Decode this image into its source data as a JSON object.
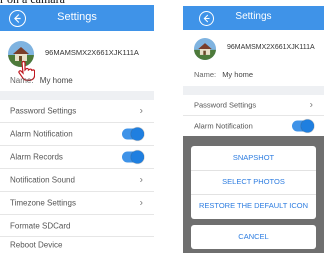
{
  "caption": "r on a camara",
  "left_screen": {
    "header_title": "Settings",
    "device_serial": "96MAMSMX2X661XJK111A",
    "name_label": "Name:",
    "name_value": "My home",
    "rows": [
      {
        "label": "Password Settings",
        "control": "chevron"
      },
      {
        "label": "Alarm Notification",
        "control": "toggle",
        "on": true
      },
      {
        "label": "Alarm Records",
        "control": "toggle",
        "on": true
      },
      {
        "label": "Notification Sound",
        "control": "chevron"
      },
      {
        "label": "Timezone Settings",
        "control": "chevron"
      },
      {
        "label": "Formate SDCard",
        "control": "none"
      },
      {
        "label": "Reboot Device",
        "control": "none"
      }
    ]
  },
  "right_screen": {
    "header_title": "Settings",
    "device_serial": "96MAMSMX2X661XJK111A",
    "name_label": "Name:",
    "name_value": "My home",
    "rows": [
      {
        "label": "Password Settings",
        "control": "chevron"
      },
      {
        "label": "Alarm Notification",
        "control": "toggle",
        "on": true
      }
    ],
    "action_sheet": {
      "options": [
        "SNAPSHOT",
        "SELECT PHOTOS",
        "RESTORE THE DEFAULT ICON"
      ],
      "cancel": "CANCEL"
    }
  },
  "colors": {
    "header": "#3f93e8",
    "accent": "#2c7ce0",
    "toggle": "#3f93e8"
  },
  "icons": {
    "back": "back-arrow-circle-icon",
    "chevron": "chevron-right-icon",
    "cursor": "hand-pointer-icon"
  }
}
